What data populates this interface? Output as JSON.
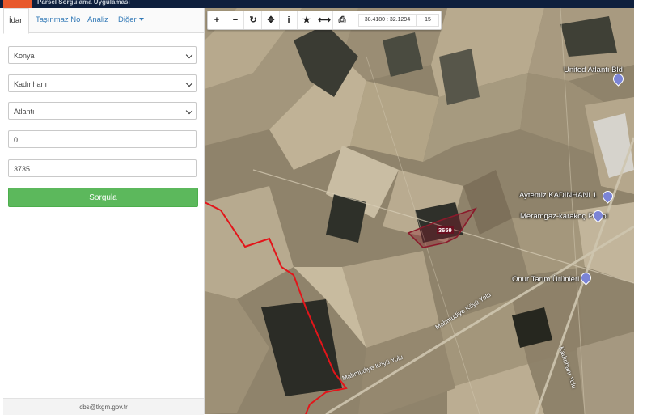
{
  "header": {
    "title": "Parsel Sorgulama Uygulaması"
  },
  "tabs": [
    {
      "label": "İdari",
      "active": true
    },
    {
      "label": "Taşınmaz No",
      "active": false
    },
    {
      "label": "Analiz",
      "active": false
    },
    {
      "label": "Diğer",
      "active": false,
      "dropdown": true
    }
  ],
  "form": {
    "province": "Konya",
    "district": "Kadınhanı",
    "neighborhood": "Atlantı",
    "block": "0",
    "parcel": "3735",
    "submit_label": "Sorgula"
  },
  "footer": {
    "email": "cbs@tkgm.gov.tr"
  },
  "toolbar": {
    "buttons": [
      {
        "icon": "zoom-in-icon",
        "glyph": "+"
      },
      {
        "icon": "zoom-out-icon",
        "glyph": "−"
      },
      {
        "icon": "refresh-icon",
        "glyph": "↻"
      },
      {
        "icon": "pan-icon",
        "glyph": "✥"
      },
      {
        "icon": "info-icon",
        "glyph": "i"
      },
      {
        "icon": "star-icon",
        "glyph": "★"
      },
      {
        "icon": "measure-icon",
        "glyph": "⟷"
      },
      {
        "icon": "print-icon",
        "glyph": "⎙"
      }
    ],
    "coordinates": "38.4180 : 32.1294",
    "zoom": "15"
  },
  "map": {
    "parcel_label": "3659",
    "places": [
      {
        "name": "United Atlantı Bld"
      },
      {
        "name": "Aytemiz KADINHANI 1"
      },
      {
        "name": "Meramgaz-karakoç Petrol"
      },
      {
        "name": "Onur Tarım Ürünleri"
      }
    ],
    "roads": [
      {
        "name": "Mahmudiye Köyü Yolu"
      },
      {
        "name": "Mahmudiye Köyü Yolu"
      },
      {
        "name": "Kadınhanı Yolu"
      }
    ],
    "colors": {
      "boundary": "#e3151a",
      "parcel": "#8b1a2b"
    }
  }
}
